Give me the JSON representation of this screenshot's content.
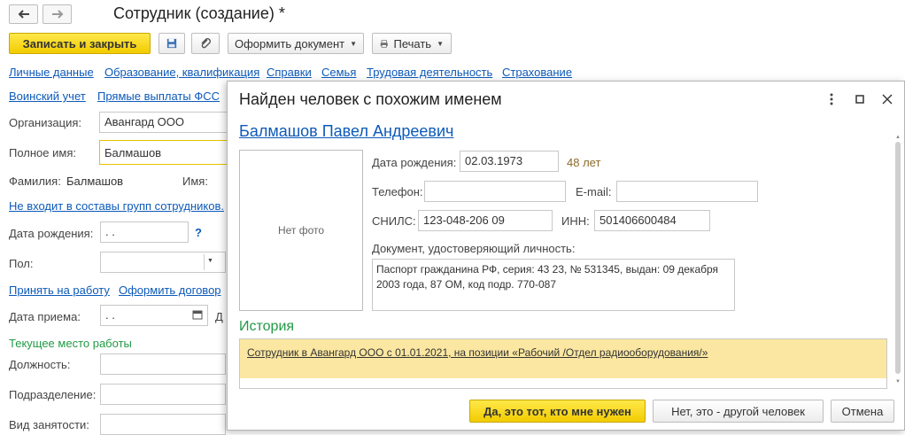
{
  "window": {
    "title": "Сотрудник (создание) *"
  },
  "toolbar": {
    "save_close": "Записать и закрыть",
    "create_doc": "Оформить документ",
    "print": "Печать"
  },
  "tabs_row1": [
    "Личные данные",
    "Образование, квалификация",
    "Справки",
    "Семья",
    "Трудовая деятельность",
    "Страхование"
  ],
  "tabs_row2": [
    "Воинский учет",
    "Прямые выплаты ФСС"
  ],
  "form": {
    "org_label": "Организация:",
    "org_value": "Авангард ООО",
    "fullname_label": "Полное имя:",
    "fullname_value": "Балмашов",
    "surname_label": "Фамилия:",
    "surname_value": "Балмашов",
    "name_label": "Имя:",
    "groups_link": "Не входит в составы групп сотрудников.",
    "birth_label": "Дата рождения:",
    "birth_value": " .  .",
    "help_mark": "?",
    "gender_label": "Пол:",
    "hire_link": "Принять на работу",
    "contract_link": "Оформить договор",
    "hire_date_label": "Дата приема:",
    "hire_date_value": " .  .",
    "hire_date_suffix": "Д",
    "current_work": "Текущее место работы",
    "position_label": "Должность:",
    "dept_label": "Подразделение:",
    "employment_label": "Вид занятости:"
  },
  "dialog": {
    "title": "Найден человек с похожим именем",
    "person_name": "Балмашов Павел Андреевич",
    "no_photo": "Нет фото",
    "birth_label": "Дата рождения:",
    "birth_value": "02.03.1973",
    "age": "48 лет",
    "phone_label": "Телефон:",
    "phone_value": "",
    "email_label": "E-mail:",
    "email_value": "",
    "snils_label": "СНИЛС:",
    "snils_value": "123-048-206 09",
    "inn_label": "ИНН:",
    "inn_value": "501406600484",
    "doc_label": "Документ, удостоверяющий личность:",
    "doc_value": "Паспорт гражданина РФ, серия: 43 23, № 531345, выдан: 09 декабря 2003 года, 87 ОМ, код подр. 770-087",
    "history_title": "История",
    "history_item": "Сотрудник в Авангард ООО с 01.01.2021, на позиции «Рабочий /Отдел радиооборудования/»",
    "btn_yes": "Да, это тот, кто мне нужен",
    "btn_no": "Нет, это - другой человек",
    "btn_cancel": "Отмена"
  },
  "colors": {
    "accent_yellow": "#f2cc00",
    "link_blue": "#0d5ab9",
    "section_green": "#229a46",
    "history_highlight": "#fbe7a1"
  }
}
